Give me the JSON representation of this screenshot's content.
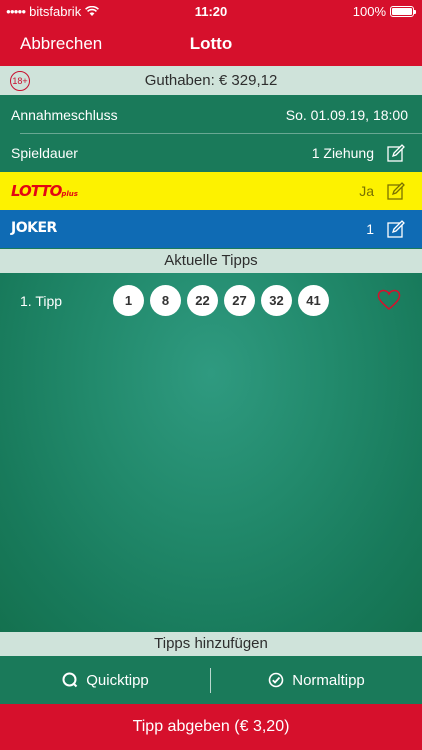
{
  "status_bar": {
    "carrier": "bitsfabrik",
    "time": "11:20",
    "battery": "100%"
  },
  "nav": {
    "cancel_label": "Abbrechen",
    "title": "Lotto"
  },
  "balance": {
    "age_badge": "18+",
    "text": "Guthaben: € 329,12"
  },
  "details": {
    "deadline_label": "Annahmeschluss",
    "deadline_value": "So. 01.09.19, 18:00",
    "duration_label": "Spieldauer",
    "duration_value": "1 Ziehung",
    "lottoplus_logo": "LOTTO",
    "lottoplus_logo_suffix": "plus",
    "lottoplus_value": "Ja",
    "joker_logo": "JOKER",
    "joker_value": "1"
  },
  "tips": {
    "section_title": "Aktuelle Tipps",
    "items": [
      {
        "label": "1. Tipp",
        "numbers": [
          "1",
          "8",
          "22",
          "27",
          "32",
          "41"
        ]
      }
    ]
  },
  "add_tips": {
    "section_title": "Tipps hinzufügen",
    "quicktipp_label": "Quicktipp",
    "normaltipp_label": "Normaltipp"
  },
  "submit": {
    "label": "Tipp abgeben (€ 3,20)"
  },
  "colors": {
    "brand_red": "#d6102c",
    "green": "#1a7a5a",
    "light_green": "#cfe3da",
    "lottoplus_yellow": "#fdf200",
    "joker_blue": "#0f6bb4"
  }
}
